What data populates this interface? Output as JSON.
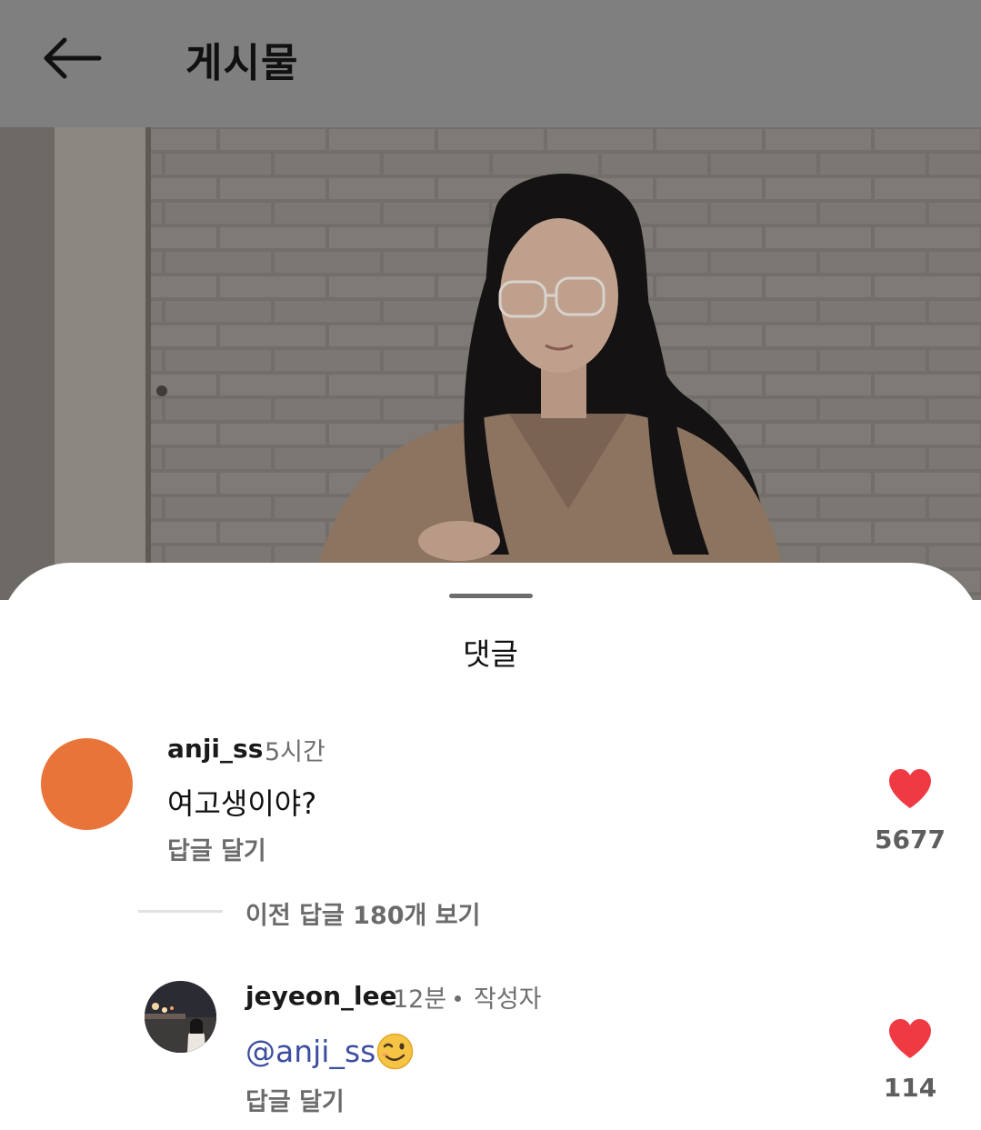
{
  "header": {
    "title": "게시물",
    "back_icon": "arrow-left-icon",
    "background": "#7f7f7f"
  },
  "sheet": {
    "title": "댓글"
  },
  "comments": [
    {
      "username": "anji_ss",
      "time": "5시간",
      "text": "여고생이야?",
      "reply_label": "답글 달기",
      "likes": "5677",
      "avatar_color": "#e9743a"
    }
  ],
  "view_replies_label": "이전 답글 180개 보기",
  "replies": [
    {
      "username": "jeyeon_lee",
      "time": "12분",
      "author_badge": "작성자",
      "mention": "@anji_ss",
      "emoji": "winking-face-icon",
      "reply_label": "답글 달기",
      "likes": "114"
    }
  ],
  "colors": {
    "heart": "#ef3a44",
    "mention": "#3c4ea0"
  }
}
